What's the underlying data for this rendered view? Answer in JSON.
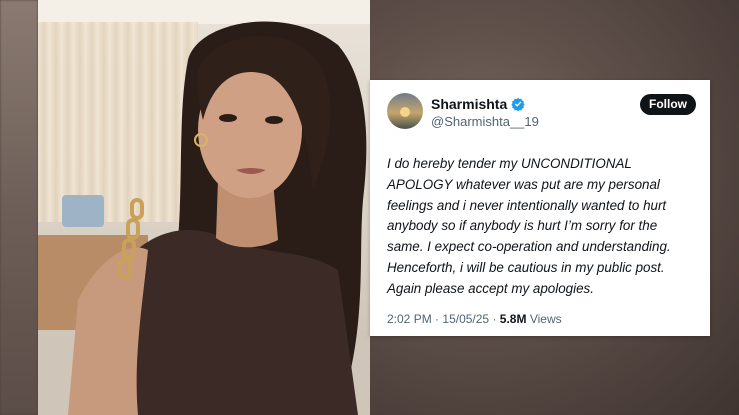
{
  "tweet": {
    "display_name": "Sharmishta",
    "handle": "@Sharmishta__19",
    "follow_label": "Follow",
    "verified_icon": "verified-badge-icon",
    "verified_color": "#1d9bf0",
    "lines": [
      "I do hereby tender my UNCONDITIONAL",
      "APOLOGY whatever was put are my personal",
      "feelings and i never intentionally wanted to hurt",
      "anybody so if anybody is hurt I’m sorry for the",
      "same. I expect co-operation and understanding.",
      "Henceforth, i will be cautious in my public post.",
      "Again please accept my apologies."
    ],
    "time": "2:02 PM",
    "separator": "·",
    "date": "15/05/25",
    "views_count": "5.8M",
    "views_label": "Views"
  },
  "colors": {
    "follow_bg": "#0f1419",
    "text_primary": "#0f1419",
    "text_secondary": "#536471"
  }
}
